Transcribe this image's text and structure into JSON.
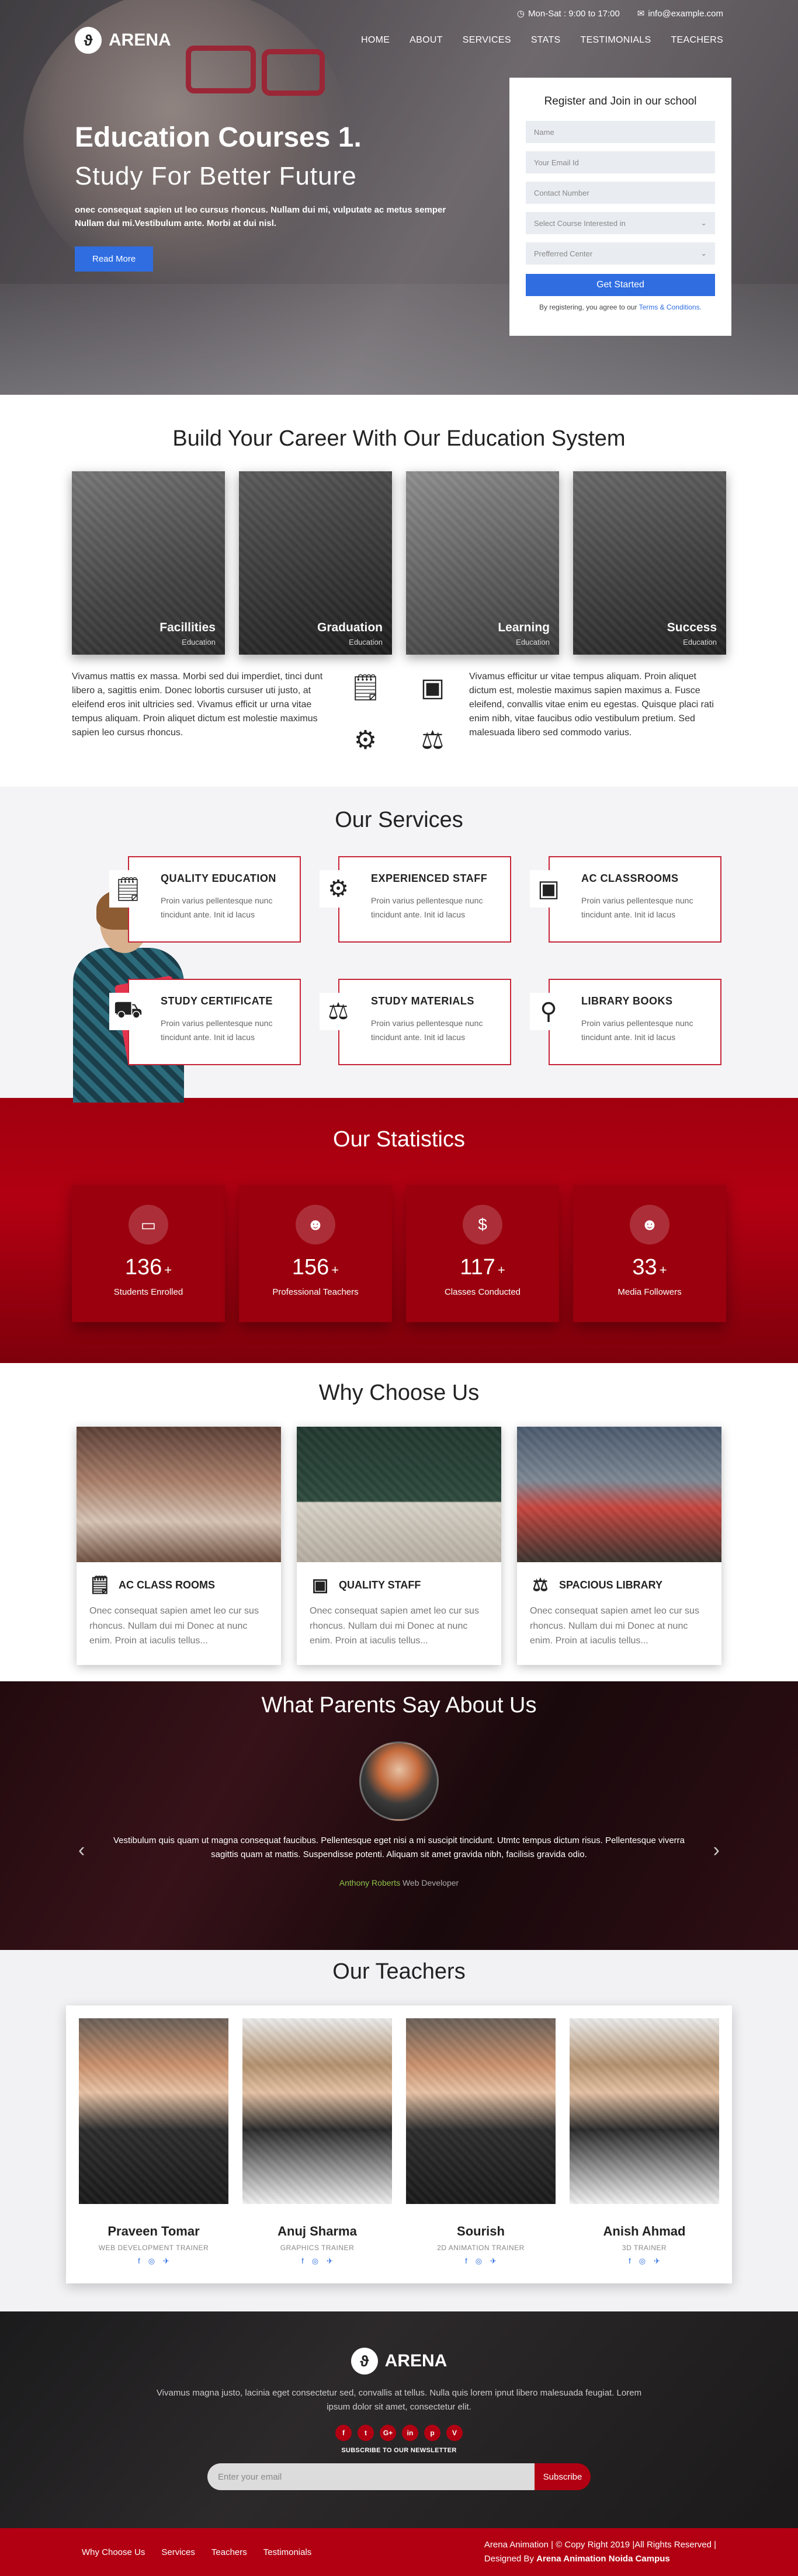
{
  "header": {
    "hours": "Mon-Sat : 9:00 to 17:00",
    "email": "info@example.com",
    "brand": "ARENA",
    "menu": [
      "HOME",
      "ABOUT",
      "SERVICES",
      "STATS",
      "TESTIMONIALS",
      "TEACHERS"
    ]
  },
  "hero": {
    "title": "Education Courses 1.",
    "subtitle": "Study For Better Future",
    "text": "onec consequat sapien ut leo cursus rhoncus. Nullam dui mi, vulputate ac metus semper Nullam dui mi.Vestibulum ante. Morbi at dui nisl.",
    "button": "Read More"
  },
  "register": {
    "title": "Register and Join in our school",
    "name_placeholder": "Name",
    "email_placeholder": "Your Email Id",
    "contact_placeholder": "Contact Number",
    "course_select": "Select Course Interested in",
    "center_select": "Prefferred Center",
    "button": "Get Started",
    "terms_prefix": "By registering, you agree to our",
    "terms_link": "Terms & Conditions."
  },
  "career": {
    "title": "Build Your Career With Our Education System",
    "cards": [
      {
        "label": "Facillities",
        "sub": "Education"
      },
      {
        "label": "Graduation",
        "sub": "Education"
      },
      {
        "label": "Learning",
        "sub": "Education"
      },
      {
        "label": "Success",
        "sub": "Education"
      }
    ],
    "left_text": "Vivamus mattis ex massa. Morbi sed dui imperdiet, tinci dunt libero a, sagittis enim. Donec lobortis cursuser uti justo, at eleifend eros init ultricies sed. Vivamus efficit ur urna vitae tempus aliquam. Proin aliquet dictum est molestie maximus sapien leo cursus rhoncus.",
    "right_text": "Vivamus efficitur ur vitae tempus aliquam. Proin aliquet dictum est, molestie maximus sapien maximus a. Fusce eleifend, convallis vitae enim eu egestas. Quisque placi rati enim nibh, vitae faucibus odio vestibulum pretium. Sed malesuada libero sed commodo varius."
  },
  "services": {
    "title": "Our Services",
    "items": [
      {
        "title": "QUALITY EDUCATION",
        "text": "Proin varius pellentesque nunc tincidunt ante. Init id lacus",
        "icon": "certificate-icon"
      },
      {
        "title": "EXPERIENCED STAFF",
        "text": "Proin varius pellentesque nunc tincidunt ante. Init id lacus",
        "icon": "brain-icon"
      },
      {
        "title": "AC CLASSROOMS",
        "text": "Proin varius pellentesque nunc tincidunt ante. Init id lacus",
        "icon": "presentation-icon"
      },
      {
        "title": "STUDY CERTIFICATE",
        "text": "Proin varius pellentesque nunc tincidunt ante. Init id lacus",
        "icon": "truck-icon"
      },
      {
        "title": "STUDY MATERIALS",
        "text": "Proin varius pellentesque nunc tincidunt ante. Init id lacus",
        "icon": "scales-icon"
      },
      {
        "title": "LIBRARY BOOKS",
        "text": "Proin varius pellentesque nunc tincidunt ante. Init id lacus",
        "icon": "magnifier-icon"
      }
    ]
  },
  "stats": {
    "title": "Our Statistics",
    "items": [
      {
        "num": "136",
        "plus": "+",
        "cap": "Students Enrolled",
        "icon": "card-icon"
      },
      {
        "num": "156",
        "plus": "+",
        "cap": "Professional Teachers",
        "icon": "group-icon"
      },
      {
        "num": "117",
        "plus": "+",
        "cap": "Classes Conducted",
        "icon": "dollar-icon"
      },
      {
        "num": "33",
        "plus": "+",
        "cap": "Media Followers",
        "icon": "group-icon"
      }
    ]
  },
  "why": {
    "title": "Why Choose Us",
    "items": [
      {
        "title": "AC CLASS ROOMS",
        "text": "Onec consequat sapien amet leo cur sus rhoncus. Nullam dui mi Donec at nunc enim. Proin at iaculis tellus...",
        "icon": "certificate-icon"
      },
      {
        "title": "QUALITY STAFF",
        "text": "Onec consequat sapien amet leo cur sus rhoncus. Nullam dui mi Donec at nunc enim. Proin at iaculis tellus...",
        "icon": "presentation-icon"
      },
      {
        "title": "SPACIOUS LIBRARY",
        "text": "Onec consequat sapien amet leo cur sus rhoncus. Nullam dui mi Donec at nunc enim. Proin at iaculis tellus...",
        "icon": "scales-icon"
      }
    ]
  },
  "testimonial": {
    "title": "What Parents Say About Us",
    "text": "Vestibulum quis quam ut magna consequat faucibus. Pellentesque eget nisi a mi suscipit tincidunt. Utmtc tempus dictum risus. Pellentesque viverra sagittis quam at mattis. Suspendisse potenti. Aliquam sit amet gravida nibh, facilisis gravida odio.",
    "name": "Anthony Roberts",
    "role": "Web Developer"
  },
  "teachers": {
    "title": "Our Teachers",
    "items": [
      {
        "name": "Praveen Tomar",
        "role": "WEB DEVELOPMENT TRAINER"
      },
      {
        "name": "Anuj Sharma",
        "role": "GRAPHICS TRAINER"
      },
      {
        "name": "Sourish",
        "role": "2D ANIMATION TRAINER"
      },
      {
        "name": "Anish Ahmad",
        "role": "3D TRAINER"
      }
    ]
  },
  "footer": {
    "brand": "ARENA",
    "text": "Vivamus magna justo, lacinia eget consectetur sed, convallis at tellus. Nulla quis lorem ipnut libero malesuada feugiat. Lorem ipsum dolor sit amet, consectetur elit.",
    "social": [
      "f",
      "t",
      "G+",
      "in",
      "p",
      "V"
    ],
    "newsletter_label": "SUBSCRIBE TO OUR NEWSLETTER",
    "email_placeholder": "Enter your email",
    "subscribe": "Subscribe",
    "links": [
      "Why Choose Us",
      "Services",
      "Teachers",
      "Testimonials"
    ],
    "copyright": "Arena Animation | © Copy Right 2019 |All Rights Reserved |",
    "designed_prefix": "Designed By",
    "designed_by": "Arena Animation Noida Campus"
  }
}
